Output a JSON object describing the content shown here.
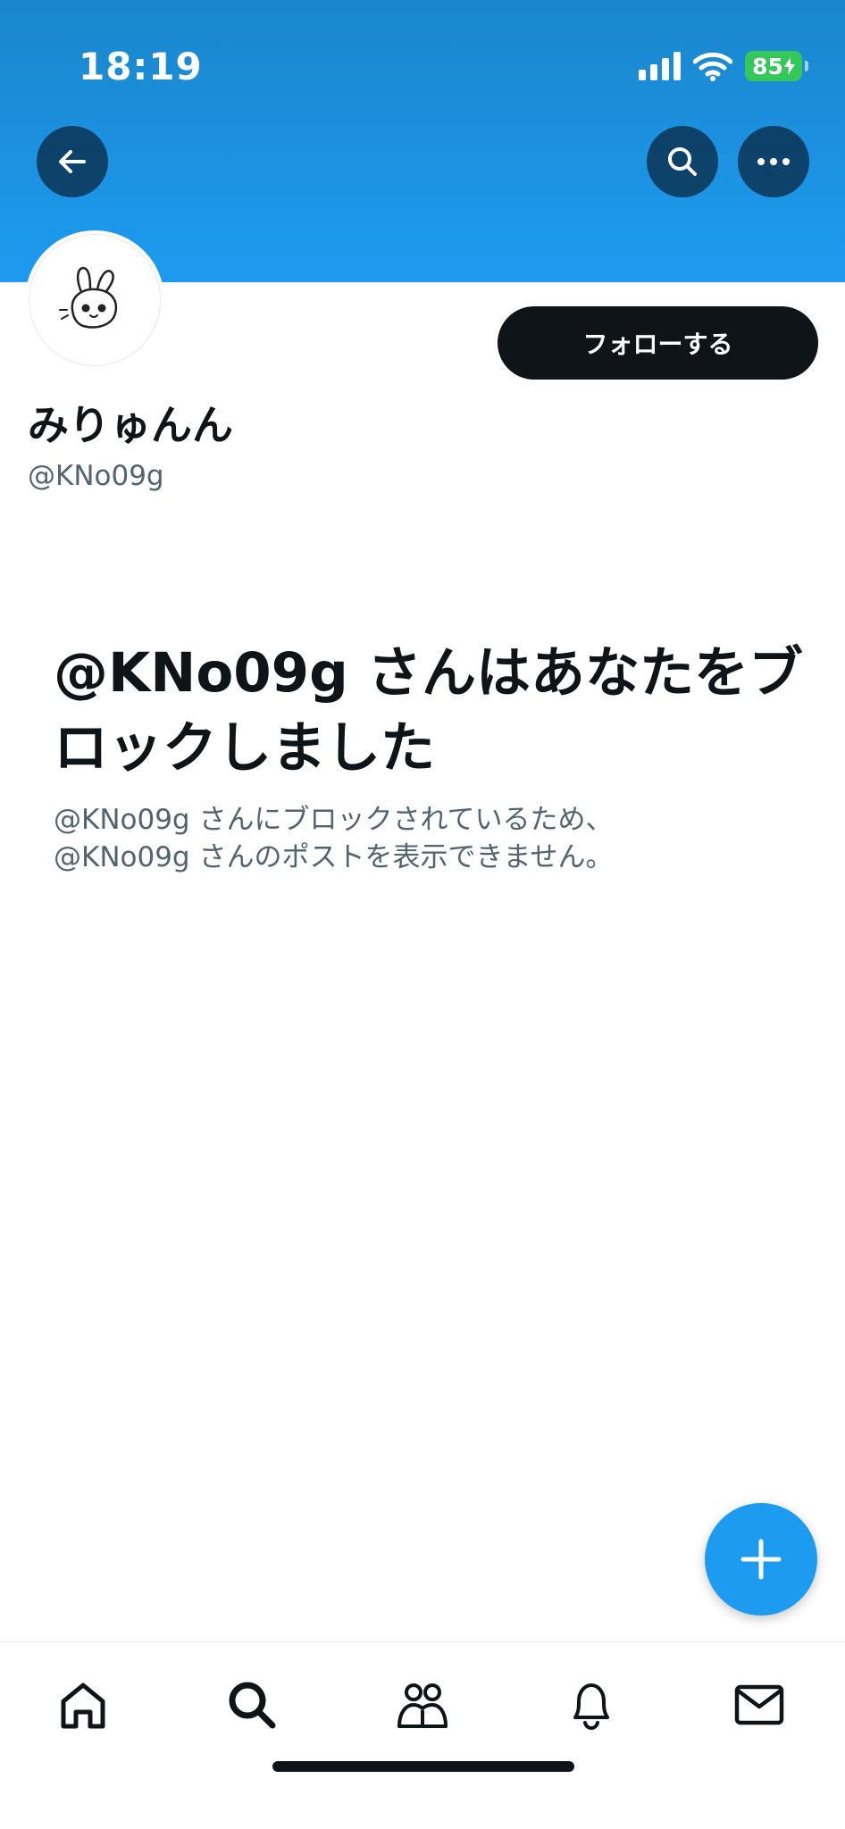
{
  "status_bar": {
    "time": "18:19",
    "battery": "85"
  },
  "header": {
    "back_icon": "arrow-left-icon",
    "search_icon": "search-icon",
    "more_icon": "ellipsis-icon",
    "color": "#1d9bf0"
  },
  "profile": {
    "display_name": "みりゅんん",
    "handle": "@KNo09g",
    "avatar_icon": "bunny-doodle-avatar",
    "follow_label": "フォローする"
  },
  "blocked": {
    "title": "@KNo09g さんはあなたをブロックしました",
    "desc_line1": "@KNo09g さんにブロックされているため、",
    "desc_line2": "@KNo09g さんのポストを表示できません。"
  },
  "fab": {
    "icon": "plus-icon",
    "color": "#1d9bf0"
  },
  "tabbar": {
    "items": [
      {
        "icon": "home-icon"
      },
      {
        "icon": "search-icon"
      },
      {
        "icon": "communities-icon"
      },
      {
        "icon": "notifications-bell-icon"
      },
      {
        "icon": "messages-envelope-icon"
      }
    ]
  }
}
